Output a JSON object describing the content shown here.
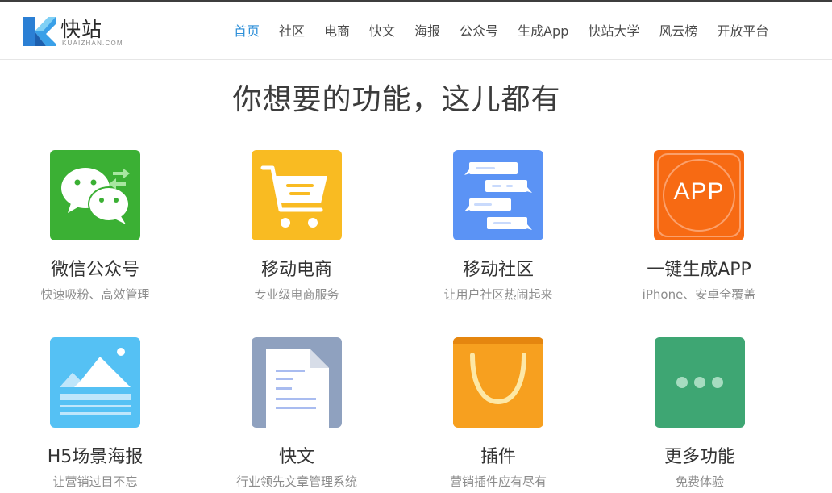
{
  "brand": {
    "name": "快站",
    "subtitle": "KUAIZHAN.COM",
    "accent": "#2b8ed8"
  },
  "nav": {
    "items": [
      {
        "label": "首页",
        "active": true
      },
      {
        "label": "社区"
      },
      {
        "label": "电商"
      },
      {
        "label": "快文"
      },
      {
        "label": "海报"
      },
      {
        "label": "公众号"
      },
      {
        "label": "生成App"
      },
      {
        "label": "快站大学"
      },
      {
        "label": "风云榜"
      },
      {
        "label": "开放平台"
      }
    ]
  },
  "hero": {
    "title": "你想要的功能，这儿都有"
  },
  "features": [
    {
      "title": "微信公众号",
      "desc": "快速吸粉、高效管理",
      "icon": "wechat-icon",
      "color": "#3bb034"
    },
    {
      "title": "移动电商",
      "desc": "专业级电商服务",
      "icon": "shopping-cart-icon",
      "color": "#f9bb22"
    },
    {
      "title": "移动社区",
      "desc": "让用户社区热闹起来",
      "icon": "chat-bubbles-icon",
      "color": "#5b93f5"
    },
    {
      "title": "一键生成APP",
      "desc": "iPhone、安卓全覆盖",
      "icon": "app-icon",
      "color": "#f76a13",
      "icon_text": "APP"
    },
    {
      "title": "H5场景海报",
      "desc": "让营销过目不忘",
      "icon": "poster-image-icon",
      "color": "#55c1f4"
    },
    {
      "title": "快文",
      "desc": "行业领先文章管理系统",
      "icon": "document-icon",
      "color": "#8fa1bf"
    },
    {
      "title": "插件",
      "desc": "营销插件应有尽有",
      "icon": "shopping-bag-icon",
      "color": "#f7a01f"
    },
    {
      "title": "更多功能",
      "desc": "免费体验",
      "icon": "more-icon",
      "color": "#3ea673"
    }
  ]
}
